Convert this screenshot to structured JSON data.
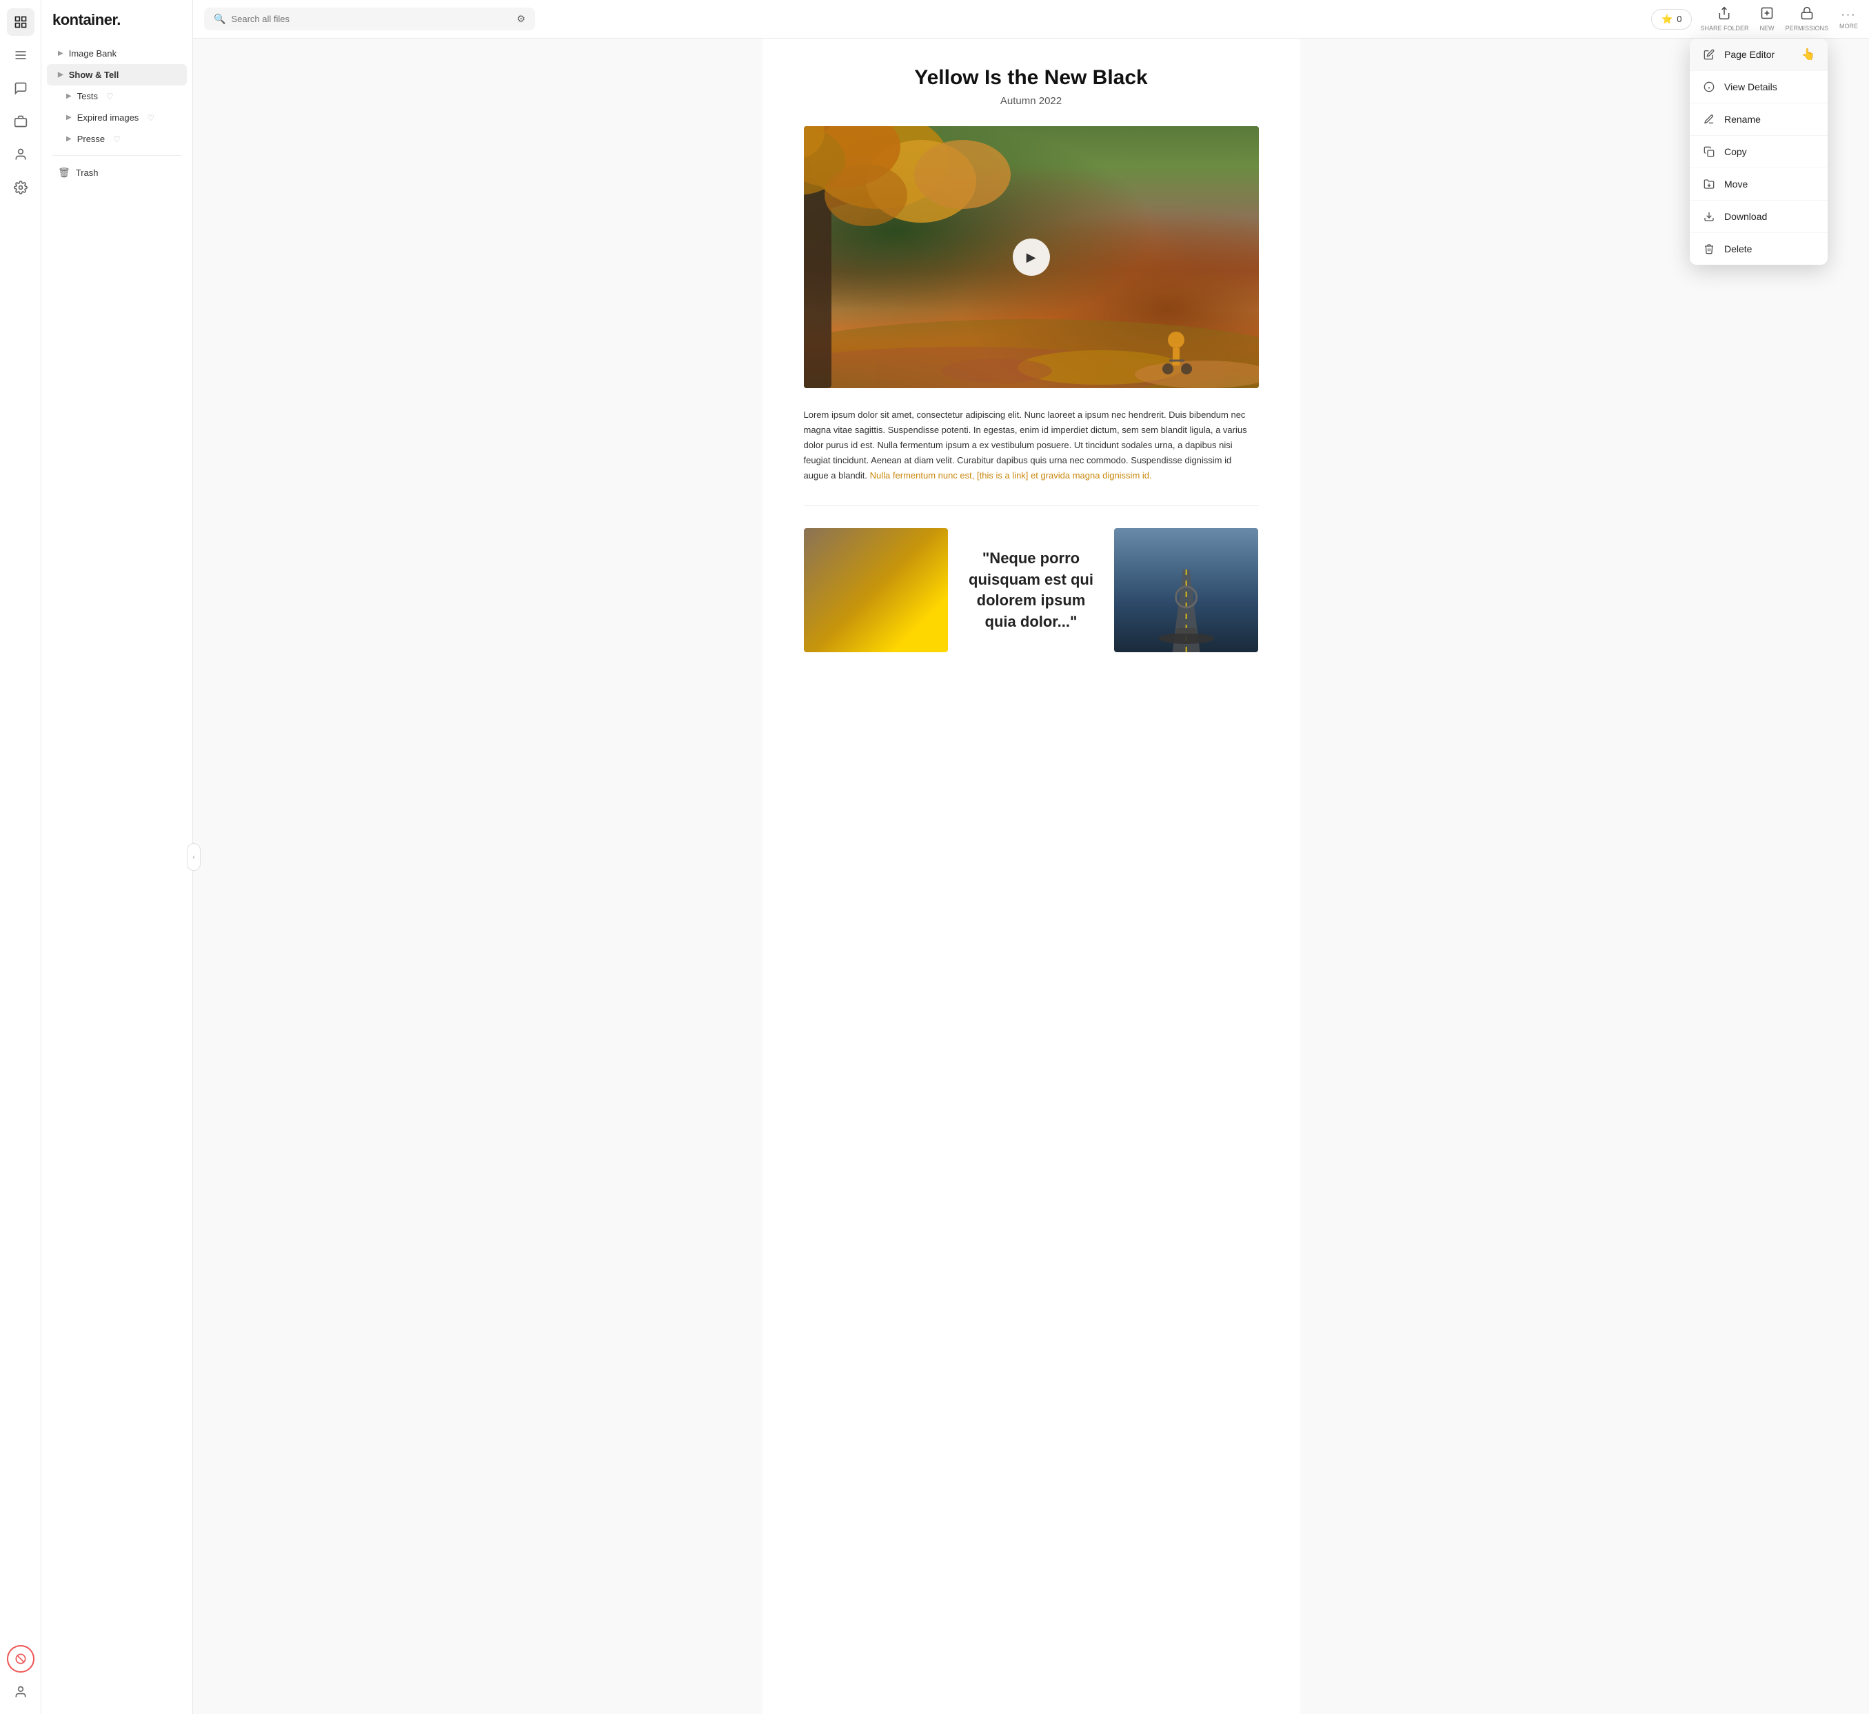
{
  "app": {
    "logo": "kontainer.",
    "search_placeholder": "Search all files"
  },
  "topbar": {
    "share_folder_label": "SHARE FOLDER",
    "new_label": "NEW",
    "permissions_label": "PERMISSIONS",
    "more_label": "MORE",
    "favorites_count": "0"
  },
  "sidebar": {
    "items": [
      {
        "id": "image-bank",
        "label": "Image Bank",
        "has_chevron": true,
        "active": false
      },
      {
        "id": "show-tell",
        "label": "Show & Tell",
        "has_chevron": true,
        "active": true
      },
      {
        "id": "tests",
        "label": "Tests",
        "has_chevron": true,
        "has_heart": true,
        "active": false
      },
      {
        "id": "expired-images",
        "label": "Expired images",
        "has_chevron": true,
        "has_heart": true,
        "active": false
      },
      {
        "id": "presse",
        "label": "Presse",
        "has_chevron": true,
        "has_heart": true,
        "active": false
      },
      {
        "id": "trash",
        "label": "Trash",
        "has_trash_icon": true,
        "active": false
      }
    ]
  },
  "page": {
    "title": "Yellow Is the New Black",
    "subtitle": "Autumn 2022",
    "body_text": "Lorem ipsum dolor sit amet, consectetur adipiscing elit. Nunc laoreet a ipsum nec hendrerit. Duis bibendum nec magna vitae sagittis. Suspendisse potenti. In egestas, enim id imperdiet dictum, sem sem blandit ligula, a varius dolor purus id est. Nulla fermentum ipsum a ex vestibulum posuere. Ut tincidunt sodales urna, a dapibus nisi feugiat tincidunt. Aenean at diam velit. Curabitur dapibus quis urna nec commodo. Suspendisse dignissim id augue a blandit.",
    "link_text": "Nulla fermentum nunc est, [this is a link] et gravida magna dignissim id.",
    "quote_text": "\"Neque porro quisquam est qui dolorem ipsum quia dolor...\""
  },
  "dropdown": {
    "items": [
      {
        "id": "page-editor",
        "label": "Page Editor",
        "icon": "pencil"
      },
      {
        "id": "view-details",
        "label": "View Details",
        "icon": "info-circle"
      },
      {
        "id": "rename",
        "label": "Rename",
        "icon": "pencil-alt"
      },
      {
        "id": "copy",
        "label": "Copy",
        "icon": "copy"
      },
      {
        "id": "move",
        "label": "Move",
        "icon": "folder-move"
      },
      {
        "id": "download",
        "label": "Download",
        "icon": "download"
      },
      {
        "id": "delete",
        "label": "Delete",
        "icon": "trash"
      }
    ]
  }
}
